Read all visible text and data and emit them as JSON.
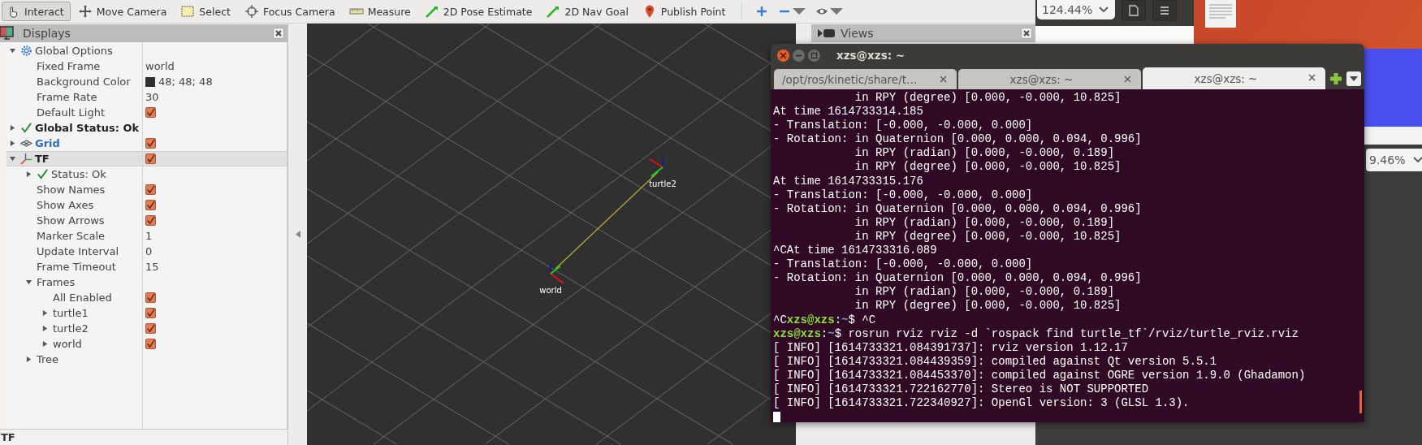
{
  "toolbar": {
    "tools": [
      {
        "kind": "interact",
        "label": "Interact",
        "selected": true
      },
      {
        "kind": "move-camera",
        "label": "Move Camera",
        "selected": false
      },
      {
        "kind": "select",
        "label": "Select",
        "selected": false
      },
      {
        "kind": "focus-camera",
        "label": "Focus Camera",
        "selected": false
      },
      {
        "kind": "measure",
        "label": "Measure",
        "selected": false
      },
      {
        "kind": "pose-estimate",
        "label": "2D Pose Estimate",
        "selected": false
      },
      {
        "kind": "nav-goal",
        "label": "2D Nav Goal",
        "selected": false
      },
      {
        "kind": "publish-point",
        "label": "Publish Point",
        "selected": false
      }
    ],
    "icon_buttons": [
      {
        "kind": "plus",
        "menu": false
      },
      {
        "kind": "minus",
        "menu": true
      },
      {
        "kind": "eye",
        "menu": true
      }
    ]
  },
  "displays": {
    "title": "Displays",
    "items": [
      {
        "kind": "options",
        "label": "Global Options",
        "selected": false,
        "expanded": true,
        "children": [
          {
            "kind": "property",
            "label": "Fixed Frame",
            "value": "world"
          },
          {
            "kind": "color",
            "label": "Background Color",
            "value": "48; 48; 48"
          },
          {
            "kind": "property",
            "label": "Frame Rate",
            "value": "30"
          },
          {
            "kind": "property",
            "label": "Default Light",
            "checked": true
          }
        ]
      },
      {
        "kind": "status",
        "label": "Global Status: Ok",
        "selected": false,
        "expanded": false
      },
      {
        "kind": "grid",
        "label": "Grid",
        "selected": false,
        "expanded": false,
        "checked": true
      },
      {
        "kind": "tf",
        "label": "TF",
        "selected": true,
        "expanded": true,
        "checked": true,
        "children": [
          {
            "kind": "status",
            "label": "Status: Ok",
            "expanded": false
          },
          {
            "kind": "property",
            "label": "Show Names",
            "checked": true
          },
          {
            "kind": "property",
            "label": "Show Axes",
            "checked": true
          },
          {
            "kind": "property",
            "label": "Show Arrows",
            "checked": true
          },
          {
            "kind": "property",
            "label": "Marker Scale",
            "value": "1"
          },
          {
            "kind": "property",
            "label": "Update Interval",
            "value": "0"
          },
          {
            "kind": "property",
            "label": "Frame Timeout",
            "value": "15"
          },
          {
            "kind": "property",
            "label": "Frames",
            "expanded": true,
            "children": [
              {
                "kind": "property",
                "label": "All Enabled",
                "checked": true
              },
              {
                "kind": "property",
                "label": "turtle1",
                "expanded": false,
                "checked": true
              },
              {
                "kind": "property",
                "label": "turtle2",
                "expanded": false,
                "checked": true
              },
              {
                "kind": "property",
                "label": "world",
                "expanded": false,
                "checked": true
              }
            ]
          },
          {
            "kind": "property",
            "label": "Tree",
            "expanded": false
          }
        ]
      }
    ],
    "description_title": "TF"
  },
  "viewport": {
    "frames": [
      {
        "label": "world"
      },
      {
        "label": "turtle2"
      }
    ]
  },
  "views": {
    "title": "Views"
  },
  "background_apps": {
    "zoom_value": "124.44%",
    "second_zoom_value": "9.46%"
  },
  "terminal": {
    "title": "xzs@xzs: ~",
    "tabs": [
      {
        "label": "/opt/ros/kinetic/share/t…",
        "selected": false
      },
      {
        "label": "xzs@xzs: ~",
        "selected": false
      },
      {
        "label": "xzs@xzs: ~",
        "selected": true
      }
    ],
    "lines": [
      {
        "segments": [
          {
            "kind": "plain",
            "text": "            in RPY (degree) [0.000, -0.000, 10.825]"
          }
        ]
      },
      {
        "segments": [
          {
            "kind": "plain",
            "text": "At time 1614733314.185"
          }
        ]
      },
      {
        "segments": [
          {
            "kind": "plain",
            "text": "- Translation: [-0.000, -0.000, 0.000]"
          }
        ]
      },
      {
        "segments": [
          {
            "kind": "plain",
            "text": "- Rotation: in Quaternion [0.000, 0.000, 0.094, 0.996]"
          }
        ]
      },
      {
        "segments": [
          {
            "kind": "plain",
            "text": "            in RPY (radian) [0.000, -0.000, 0.189]"
          }
        ]
      },
      {
        "segments": [
          {
            "kind": "plain",
            "text": "            in RPY (degree) [0.000, -0.000, 10.825]"
          }
        ]
      },
      {
        "segments": [
          {
            "kind": "plain",
            "text": "At time 1614733315.176"
          }
        ]
      },
      {
        "segments": [
          {
            "kind": "plain",
            "text": "- Translation: [-0.000, -0.000, 0.000]"
          }
        ]
      },
      {
        "segments": [
          {
            "kind": "plain",
            "text": "- Rotation: in Quaternion [0.000, 0.000, 0.094, 0.996]"
          }
        ]
      },
      {
        "segments": [
          {
            "kind": "plain",
            "text": "            in RPY (radian) [0.000, -0.000, 0.189]"
          }
        ]
      },
      {
        "segments": [
          {
            "kind": "plain",
            "text": "            in RPY (degree) [0.000, -0.000, 10.825]"
          }
        ]
      },
      {
        "segments": [
          {
            "kind": "plain",
            "text": "^CAt time 1614733316.089"
          }
        ]
      },
      {
        "segments": [
          {
            "kind": "plain",
            "text": "- Translation: [-0.000, -0.000, 0.000]"
          }
        ]
      },
      {
        "segments": [
          {
            "kind": "plain",
            "text": "- Rotation: in Quaternion [0.000, 0.000, 0.094, 0.996]"
          }
        ]
      },
      {
        "segments": [
          {
            "kind": "plain",
            "text": "            in RPY (radian) [0.000, -0.000, 0.189]"
          }
        ]
      },
      {
        "segments": [
          {
            "kind": "plain",
            "text": "            in RPY (degree) [0.000, -0.000, 10.825]"
          }
        ]
      },
      {
        "segments": [
          {
            "kind": "plain",
            "text": "^C"
          },
          {
            "kind": "user",
            "text": "xzs@xzs"
          },
          {
            "kind": "plain",
            "text": ":"
          },
          {
            "kind": "path",
            "text": "~"
          },
          {
            "kind": "plain",
            "text": "$ ^C"
          }
        ]
      },
      {
        "segments": [
          {
            "kind": "user",
            "text": "xzs@xzs"
          },
          {
            "kind": "plain",
            "text": ":"
          },
          {
            "kind": "path",
            "text": "~"
          },
          {
            "kind": "plain",
            "text": "$ rosrun rviz rviz -d `rospack find turtle_tf`/rviz/turtle_rviz.rviz"
          }
        ]
      },
      {
        "segments": [
          {
            "kind": "plain",
            "text": "[ INFO] [1614733321.084391737]: rviz version 1.12.17"
          }
        ]
      },
      {
        "segments": [
          {
            "kind": "plain",
            "text": "[ INFO] [1614733321.084439359]: compiled against Qt version 5.5.1"
          }
        ]
      },
      {
        "segments": [
          {
            "kind": "plain",
            "text": "[ INFO] [1614733321.084453370]: compiled against OGRE version 1.9.0 (Ghadamon)"
          }
        ]
      },
      {
        "segments": [
          {
            "kind": "plain",
            "text": "[ INFO] [1614733321.722162770]: Stereo is NOT SUPPORTED"
          }
        ]
      },
      {
        "segments": [
          {
            "kind": "plain",
            "text": "[ INFO] [1614733321.722340927]: OpenGl version: 3 (GLSL 1.3)."
          }
        ]
      }
    ]
  }
}
